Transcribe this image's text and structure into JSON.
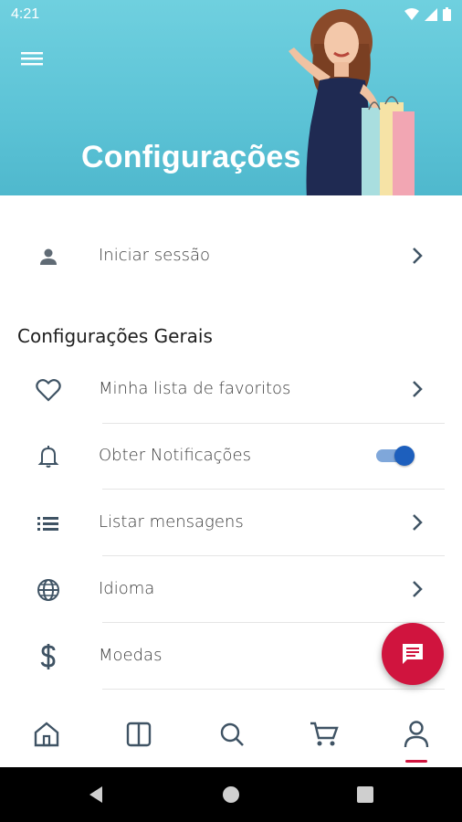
{
  "status_bar": {
    "time": "4:21"
  },
  "header": {
    "title": "Configurações"
  },
  "login": {
    "label": "Iniciar sessão"
  },
  "general": {
    "title": "Configurações Gerais",
    "items": [
      {
        "label": "Minha lista de favoritos",
        "icon": "heart-icon"
      },
      {
        "label": "Obter Notificações",
        "icon": "bell-icon",
        "toggle": true
      },
      {
        "label": "Listar mensagens",
        "icon": "list-icon"
      },
      {
        "label": "Idioma",
        "icon": "globe-icon"
      },
      {
        "label": "Moedas",
        "icon": "dollar-icon"
      }
    ]
  },
  "bottom_nav": {
    "items": [
      "home-icon",
      "layout-icon",
      "search-icon",
      "cart-icon",
      "profile-icon"
    ],
    "active": "profile-icon"
  },
  "colors": {
    "accent": "#d0143e",
    "header_bg": "#5cc3d6",
    "toggle_on": "#1d5fbd",
    "icon": "#3f5364"
  }
}
